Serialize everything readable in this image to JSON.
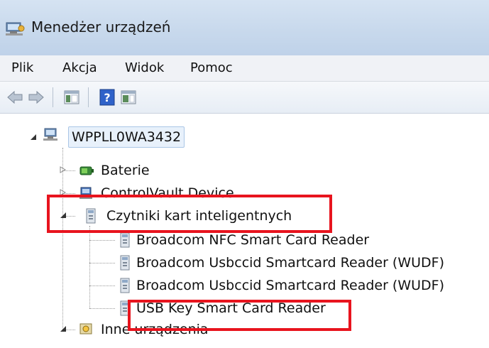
{
  "window": {
    "title": "Menedżer urządzeń"
  },
  "menu": [
    "Plik",
    "Akcja",
    "Widok",
    "Pomoc"
  ],
  "toolbar": {
    "icons": [
      "back-arrow-icon",
      "forward-arrow-icon",
      "show-hide-console-tree-icon",
      "help-icon",
      "show-action-pane-icon"
    ]
  },
  "tree": {
    "root": "WPPLL0WA3432",
    "items": [
      {
        "label": "Baterie",
        "icon": "battery-icon",
        "state": "collapsed"
      },
      {
        "label": "ControlVault Device",
        "icon": "controlvault-device-icon",
        "state": "collapsed"
      },
      {
        "label": "Czytniki kart inteligentnych",
        "icon": "smart-card-reader-icon",
        "state": "expanded",
        "children": [
          "Broadcom NFC Smart Card Reader",
          "Broadcom Usbccid Smartcard Reader (WUDF)",
          "Broadcom Usbccid Smartcard Reader (WUDF)",
          "USB Key Smart Card Reader"
        ]
      },
      {
        "label": "Inne urządzenia",
        "icon": "unknown-device-icon",
        "state": "expanded"
      }
    ]
  },
  "colors": {
    "highlight": "#e8141e",
    "titlebar": "#c7d8ec",
    "selection": "#e8f1fb"
  }
}
